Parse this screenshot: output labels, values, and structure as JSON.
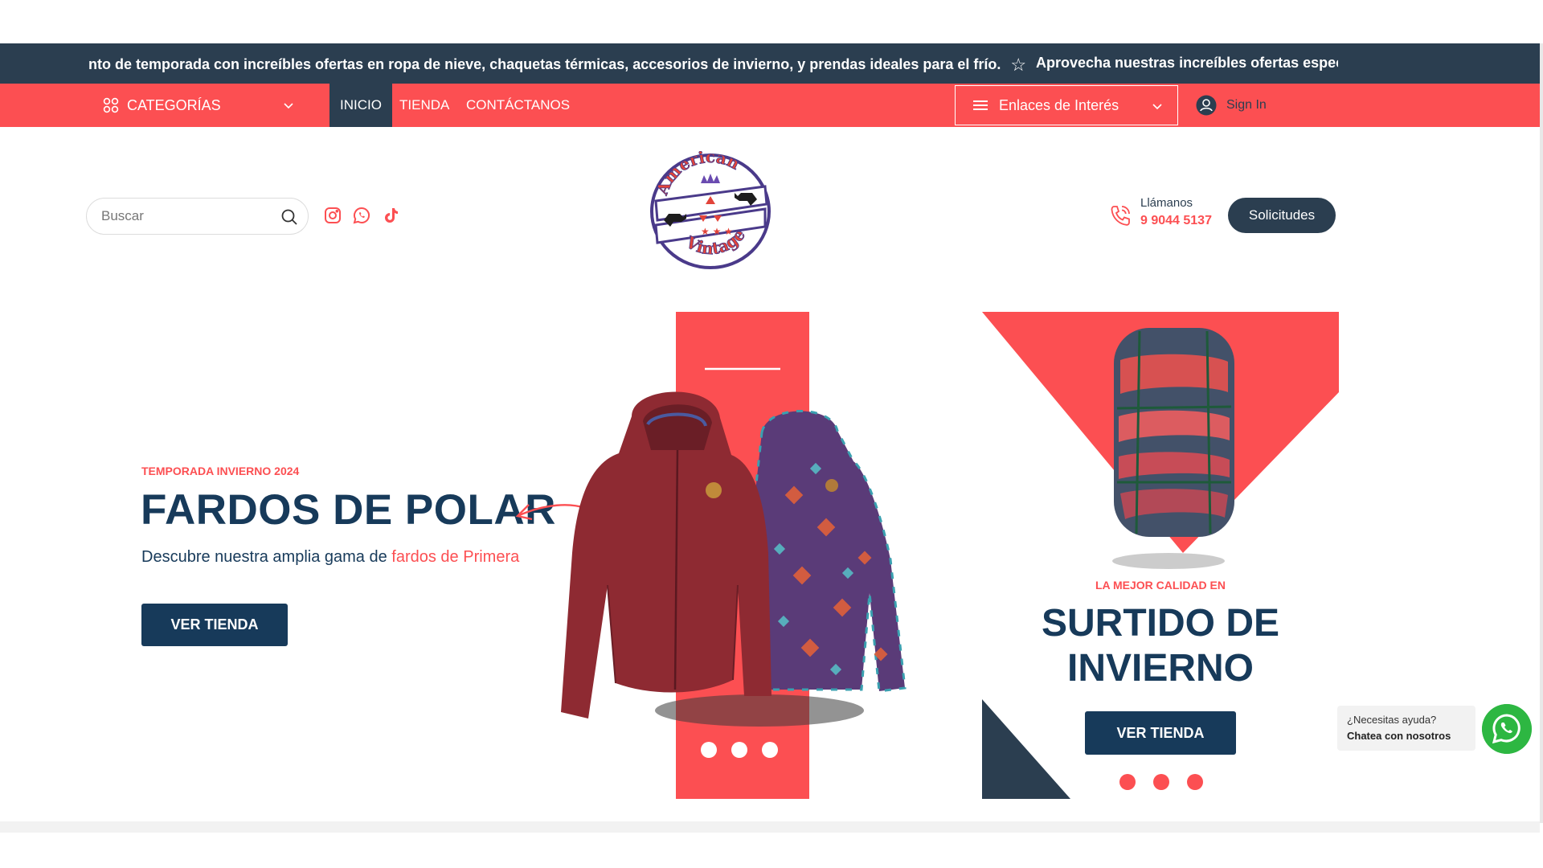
{
  "ticker": {
    "text_1": "nto de temporada con increíbles ofertas en ropa de nieve, chaquetas térmicas, accesorios de invierno, y prendas ideales para el frío.",
    "text_2": "Aprovecha nuestras increíbles ofertas especiale",
    "icon": "star-icon"
  },
  "navbar": {
    "categories_label": "CATEGORÍAS",
    "items": [
      {
        "label": "INICIO",
        "active": true
      },
      {
        "label": "TIENDA",
        "active": false
      },
      {
        "label": "CONTÁCTANOS",
        "active": false
      }
    ],
    "links_dropdown_label": "Enlaces de Interés",
    "signin_label": "Sign In"
  },
  "header": {
    "search_placeholder": "Buscar",
    "social_icons": [
      "instagram-icon",
      "whatsapp-icon",
      "tiktok-icon"
    ],
    "call_label": "Llámanos",
    "call_number": "9 9044 5137",
    "solicitudes_label": "Solicitudes"
  },
  "hero": {
    "eyebrow": "TEMPORADA INVIERNO 2024",
    "title": "FARDOS DE POLAR",
    "desc_plain": "Descubre nuestra amplia gama de ",
    "desc_highlight": "fardos de Primera",
    "button_label": "VER TIENDA"
  },
  "banner2": {
    "eyebrow": "LA MEJOR CALIDAD EN",
    "title_line1": "SURTIDO DE",
    "title_line2": "INVIERNO",
    "button_label": "VER TIENDA"
  },
  "whatsapp": {
    "help_line1": "¿Necesitas ayuda?",
    "help_line2": "Chatea con nosotros"
  },
  "colors": {
    "primary_red": "#fc4f52",
    "navy": "#2b3e50",
    "dark_navy": "#173a5a",
    "whatsapp_green": "#2db742"
  }
}
